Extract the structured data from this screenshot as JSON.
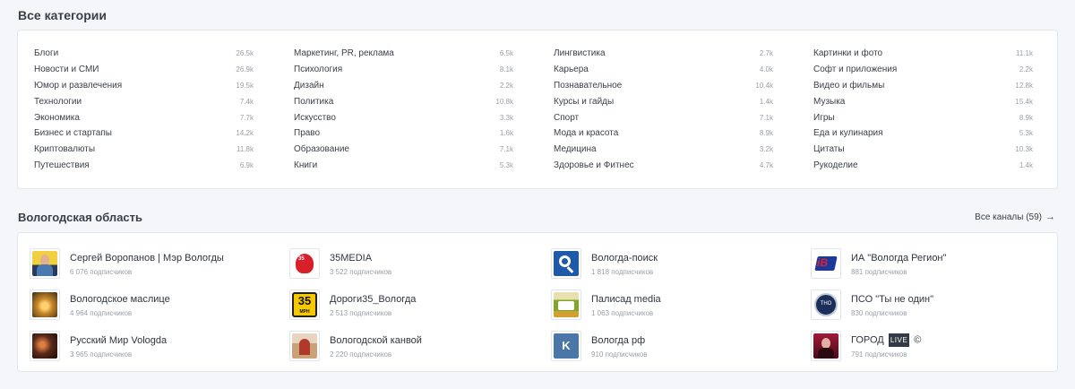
{
  "categories_section": {
    "title": "Все категории"
  },
  "categories": [
    [
      {
        "name": "Блоги",
        "count": "26.5k"
      },
      {
        "name": "Новости и СМИ",
        "count": "26.9k"
      },
      {
        "name": "Юмор и развлечения",
        "count": "19.5k"
      },
      {
        "name": "Технологии",
        "count": "7.4k"
      },
      {
        "name": "Экономика",
        "count": "7.7k"
      },
      {
        "name": "Бизнес и стартапы",
        "count": "14.2k"
      },
      {
        "name": "Криптовалюты",
        "count": "11.8k"
      },
      {
        "name": "Путешествия",
        "count": "6.9k"
      }
    ],
    [
      {
        "name": "Маркетинг, PR, реклама",
        "count": "6.5k"
      },
      {
        "name": "Психология",
        "count": "8.1k"
      },
      {
        "name": "Дизайн",
        "count": "2.2k"
      },
      {
        "name": "Политика",
        "count": "10.8k"
      },
      {
        "name": "Искусство",
        "count": "3.3k"
      },
      {
        "name": "Право",
        "count": "1.6k"
      },
      {
        "name": "Образование",
        "count": "7.1k"
      },
      {
        "name": "Книги",
        "count": "5.3k"
      }
    ],
    [
      {
        "name": "Лингвистика",
        "count": "2.7k"
      },
      {
        "name": "Карьера",
        "count": "4.0k"
      },
      {
        "name": "Познавательное",
        "count": "10.4k"
      },
      {
        "name": "Курсы и гайды",
        "count": "1.4k"
      },
      {
        "name": "Спорт",
        "count": "7.1k"
      },
      {
        "name": "Мода и красота",
        "count": "8.9k"
      },
      {
        "name": "Медицина",
        "count": "3.2k"
      },
      {
        "name": "Здоровье и Фитнес",
        "count": "4.7k"
      }
    ],
    [
      {
        "name": "Картинки и фото",
        "count": "11.1k"
      },
      {
        "name": "Софт и приложения",
        "count": "2.2k"
      },
      {
        "name": "Видео и фильмы",
        "count": "12.8k"
      },
      {
        "name": "Музыка",
        "count": "15.4k"
      },
      {
        "name": "Игры",
        "count": "8.9k"
      },
      {
        "name": "Еда и кулинария",
        "count": "5.3k"
      },
      {
        "name": "Цитаты",
        "count": "10.3k"
      },
      {
        "name": "Рукоделие",
        "count": "1.4k"
      }
    ]
  ],
  "region_section": {
    "title": "Вологодская область",
    "all_channels_link": "Все каналы (59)"
  },
  "channels": [
    [
      {
        "name": "Сергей Воропанов | Мэр Вологды",
        "subs": "6 076 подписчиков",
        "icon": "person-portrait-icon",
        "color": "#4a78b0"
      },
      {
        "name": "Вологодское маслице",
        "subs": "4 964 подписчиков",
        "icon": "sunset-photo-icon",
        "color": "#c98a2a"
      },
      {
        "name": "Русский Мир Vologda",
        "subs": "3 965 подписчиков",
        "icon": "dark-photo-icon",
        "color": "#5a2a1a"
      }
    ],
    [
      {
        "name": "35MEDIA",
        "subs": "3 522 подписчиков",
        "icon": "35media-logo-icon",
        "color": "#d8202a"
      },
      {
        "name": "Дороги35_Вологда",
        "subs": "2 513 подписчиков",
        "icon": "road-sign-35-icon",
        "color": "#f5c800",
        "sign_num": "35",
        "sign_unit": "МРН"
      },
      {
        "name": "Вологодской канвой",
        "subs": "2 220 подписчиков",
        "icon": "church-photo-icon",
        "color": "#c9a27a"
      }
    ],
    [
      {
        "name": "Вологда-поиск",
        "subs": "1 818 подписчиков",
        "icon": "search-magnifier-icon",
        "color": "#1e5aa8"
      },
      {
        "name": "Палисад media",
        "subs": "1 063 подписчиков",
        "icon": "palisad-logo-icon",
        "color": "#7fa82a"
      },
      {
        "name": "Вологда рф",
        "subs": "910 подписчиков",
        "icon": "vk-logo-icon",
        "color": "#4a76a8"
      }
    ],
    [
      {
        "name": "ИА \"Вологда Регион\"",
        "subs": "881 подписчиков",
        "icon": "vr-logo-icon",
        "color": "#1a3a9a"
      },
      {
        "name": "ПСО \"Ты не один\"",
        "subs": "830 подписчиков",
        "icon": "pso-emblem-icon",
        "color": "#1b2f5a"
      },
      {
        "name": "ГОРОД LIVE ©",
        "name_prefix": "ГОРОД",
        "name_badge": "LIVE",
        "name_suffix": "©",
        "subs": "791 подписчиков",
        "icon": "portrait-photo-icon",
        "color": "#a01a3a"
      }
    ]
  ]
}
